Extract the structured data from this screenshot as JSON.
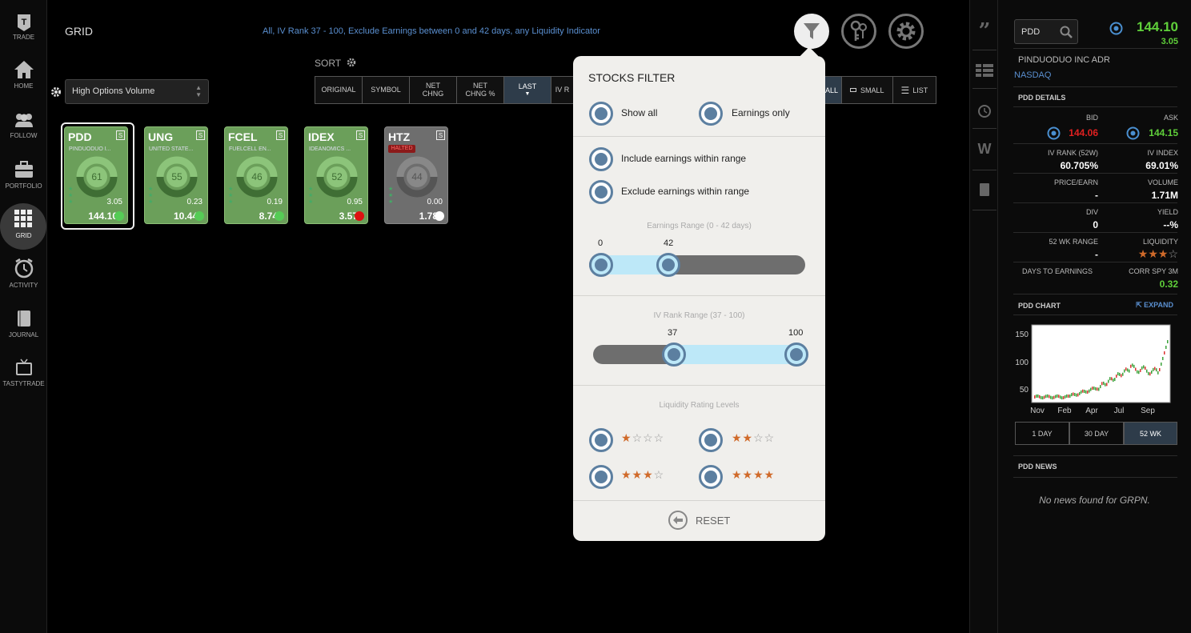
{
  "nav": [
    {
      "label": "TRADE",
      "icon": "trade-icon"
    },
    {
      "label": "HOME",
      "icon": "home-icon"
    },
    {
      "label": "FOLLOW",
      "icon": "follow-icon"
    },
    {
      "label": "PORTFOLIO",
      "icon": "portfolio-icon"
    },
    {
      "label": "GRID",
      "icon": "grid-icon",
      "active": true
    },
    {
      "label": "ACTIVITY",
      "icon": "activity-icon"
    },
    {
      "label": "JOURNAL",
      "icon": "journal-icon"
    },
    {
      "label": "TASTYTRADE",
      "icon": "tastytrade-icon"
    }
  ],
  "header": {
    "title": "GRID",
    "filter_summary": "All, IV Rank 37 - 100, Exclude Earnings between 0 and 42 days, any Liquidity Indicator"
  },
  "watchlist": {
    "selected": "High Options Volume"
  },
  "sort": {
    "label": "SORT",
    "buttons": [
      "ORIGINAL",
      "SYMBOL",
      "NET CHNG",
      "NET CHNG %",
      "LAST",
      "IV R"
    ],
    "active": "LAST"
  },
  "view": {
    "buttons": [
      "ALL",
      "SMALL",
      "LIST"
    ]
  },
  "tiles": [
    {
      "symbol": "PDD",
      "name": "PINDUODUO I...",
      "iv": "61",
      "change": "3.05",
      "last": "144.10",
      "color": "green"
    },
    {
      "symbol": "UNG",
      "name": "UNITED STATE...",
      "iv": "55",
      "change": "0.23",
      "last": "10.44",
      "color": "green"
    },
    {
      "symbol": "FCEL",
      "name": "FUELCELL EN...",
      "iv": "46",
      "change": "0.19",
      "last": "8.74",
      "color": "green"
    },
    {
      "symbol": "IDEX",
      "name": "IDEANOMICS ...",
      "iv": "52",
      "change": "0.95",
      "last": "3.57",
      "color": "green"
    },
    {
      "symbol": "HTZ",
      "name": "",
      "badge": "HALTED",
      "iv": "44",
      "change": "0.00",
      "last": "1.78",
      "color": "gray"
    }
  ],
  "tile_badge": "S",
  "filter": {
    "title": "STOCKS FILTER",
    "show_all": "Show all",
    "earnings_only": "Earnings only",
    "include": "Include earnings within range",
    "exclude": "Exclude earnings within range",
    "earnings_range_label": "Earnings Range (0 - 42 days)",
    "earnings_min": "0",
    "earnings_max": "42",
    "ivr_label": "IV Rank Range (37 - 100)",
    "ivr_min": "37",
    "ivr_max": "100",
    "liquidity_label": "Liquidity Rating Levels",
    "liquidity_levels": [
      1,
      2,
      3,
      4
    ],
    "reset": "RESET"
  },
  "quote": {
    "symbol_input": "PDD",
    "price": "144.10",
    "change": "3.05",
    "company": "PINDUODUO INC ADR",
    "exchange": "NASDAQ",
    "details_header": "PDD DETAILS",
    "bid_label": "BID",
    "bid": "144.06",
    "ask_label": "ASK",
    "ask": "144.15",
    "ivrank_label": "IV RANK (52W)",
    "ivrank": "60.705%",
    "ivindex_label": "IV INDEX",
    "ivindex": "69.01%",
    "pe_label": "PRICE/EARN",
    "pe": "-",
    "volume_label": "VOLUME",
    "volume": "1.71M",
    "div_label": "DIV",
    "div": "0",
    "yield_label": "YIELD",
    "yield": "--%",
    "range_label": "52 WK RANGE",
    "range": "-",
    "liquidity_label": "LIQUIDITY",
    "liquidity_stars": 3,
    "days_label": "DAYS TO EARNINGS",
    "corr_label": "CORR SPY 3M",
    "corr": "0.32",
    "chart_header": "PDD CHART",
    "expand": "EXPAND",
    "chart_ticks_y": [
      "150",
      "100",
      "50"
    ],
    "chart_ticks_x": [
      "Nov",
      "Feb",
      "Apr",
      "Jul",
      "Sep"
    ],
    "ranges": [
      "1 DAY",
      "30 DAY",
      "52 WK"
    ],
    "active_range": "52 WK",
    "news_header": "PDD NEWS",
    "news_empty": "No news found for GRPN."
  },
  "colors": {
    "accent": "#5c7fa0",
    "up": "#5fcf3a",
    "down": "#e02020",
    "star": "#d06a2a"
  }
}
